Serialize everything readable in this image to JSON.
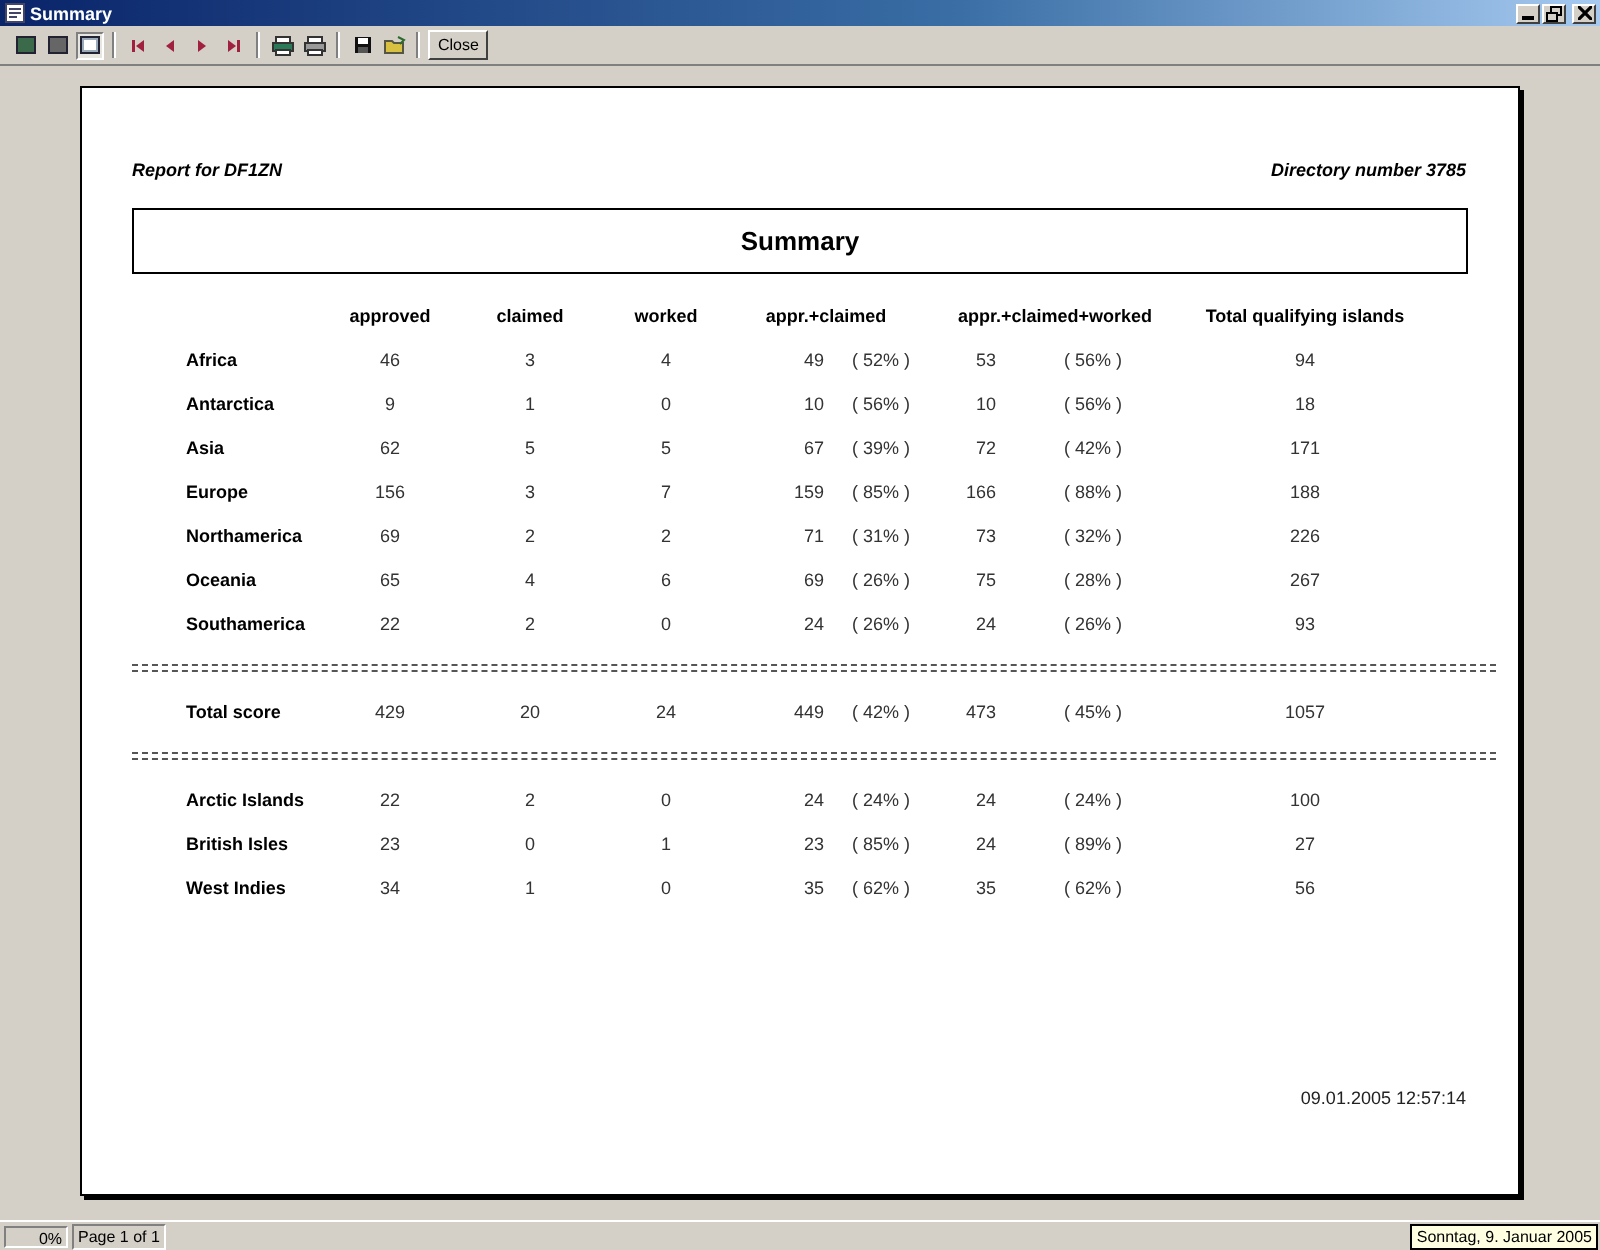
{
  "window": {
    "title": "Summary"
  },
  "toolbar": {
    "view_buttons": [
      {
        "selected": false
      },
      {
        "selected": false
      },
      {
        "selected": true
      }
    ],
    "close_button": "Close"
  },
  "report": {
    "left_header": "Report for DF1ZN",
    "right_header": "Directory number 3785",
    "title": "Summary",
    "footer_timestamp": "09.01.2005 12:57:14"
  },
  "table": {
    "columns": [
      "approved",
      "claimed",
      "worked",
      "appr.+claimed",
      "appr.+claimed+worked",
      "Total qualifying islands"
    ],
    "sections": [
      {
        "rows": [
          {
            "name": "Africa",
            "approved": "46",
            "claimed": "3",
            "worked": "4",
            "appr_claimed": "49",
            "appr_claimed_pct": "( 52% )",
            "appr_claimed_worked": "53",
            "appr_claimed_worked_pct": "( 56% )",
            "total": "94"
          },
          {
            "name": "Antarctica",
            "approved": "9",
            "claimed": "1",
            "worked": "0",
            "appr_claimed": "10",
            "appr_claimed_pct": "( 56% )",
            "appr_claimed_worked": "10",
            "appr_claimed_worked_pct": "( 56% )",
            "total": "18"
          },
          {
            "name": "Asia",
            "approved": "62",
            "claimed": "5",
            "worked": "5",
            "appr_claimed": "67",
            "appr_claimed_pct": "( 39% )",
            "appr_claimed_worked": "72",
            "appr_claimed_worked_pct": "( 42% )",
            "total": "171"
          },
          {
            "name": "Europe",
            "approved": "156",
            "claimed": "3",
            "worked": "7",
            "appr_claimed": "159",
            "appr_claimed_pct": "( 85% )",
            "appr_claimed_worked": "166",
            "appr_claimed_worked_pct": "( 88% )",
            "total": "188"
          },
          {
            "name": "Northamerica",
            "approved": "69",
            "claimed": "2",
            "worked": "2",
            "appr_claimed": "71",
            "appr_claimed_pct": "( 31% )",
            "appr_claimed_worked": "73",
            "appr_claimed_worked_pct": "( 32% )",
            "total": "226"
          },
          {
            "name": "Oceania",
            "approved": "65",
            "claimed": "4",
            "worked": "6",
            "appr_claimed": "69",
            "appr_claimed_pct": "( 26% )",
            "appr_claimed_worked": "75",
            "appr_claimed_worked_pct": "( 28% )",
            "total": "267"
          },
          {
            "name": "Southamerica",
            "approved": "22",
            "claimed": "2",
            "worked": "0",
            "appr_claimed": "24",
            "appr_claimed_pct": "( 26% )",
            "appr_claimed_worked": "24",
            "appr_claimed_worked_pct": "( 26% )",
            "total": "93"
          }
        ]
      },
      {
        "rows": [
          {
            "name": "Total score",
            "approved": "429",
            "claimed": "20",
            "worked": "24",
            "appr_claimed": "449",
            "appr_claimed_pct": "( 42% )",
            "appr_claimed_worked": "473",
            "appr_claimed_worked_pct": "( 45% )",
            "total": "1057"
          }
        ]
      },
      {
        "rows": [
          {
            "name": "Arctic Islands",
            "approved": "22",
            "claimed": "2",
            "worked": "0",
            "appr_claimed": "24",
            "appr_claimed_pct": "( 24% )",
            "appr_claimed_worked": "24",
            "appr_claimed_worked_pct": "( 24% )",
            "total": "100"
          },
          {
            "name": "British Isles",
            "approved": "23",
            "claimed": "0",
            "worked": "1",
            "appr_claimed": "23",
            "appr_claimed_pct": "( 85% )",
            "appr_claimed_worked": "24",
            "appr_claimed_worked_pct": "( 89% )",
            "total": "27"
          },
          {
            "name": "West Indies",
            "approved": "34",
            "claimed": "1",
            "worked": "0",
            "appr_claimed": "35",
            "appr_claimed_pct": "( 62% )",
            "appr_claimed_worked": "35",
            "appr_claimed_worked_pct": "( 62% )",
            "total": "56"
          }
        ]
      }
    ]
  },
  "status_bar": {
    "progress": "0%",
    "page": "Page 1 of 1"
  },
  "tooltip": {
    "text": "Sonntag, 9. Januar 2005"
  }
}
